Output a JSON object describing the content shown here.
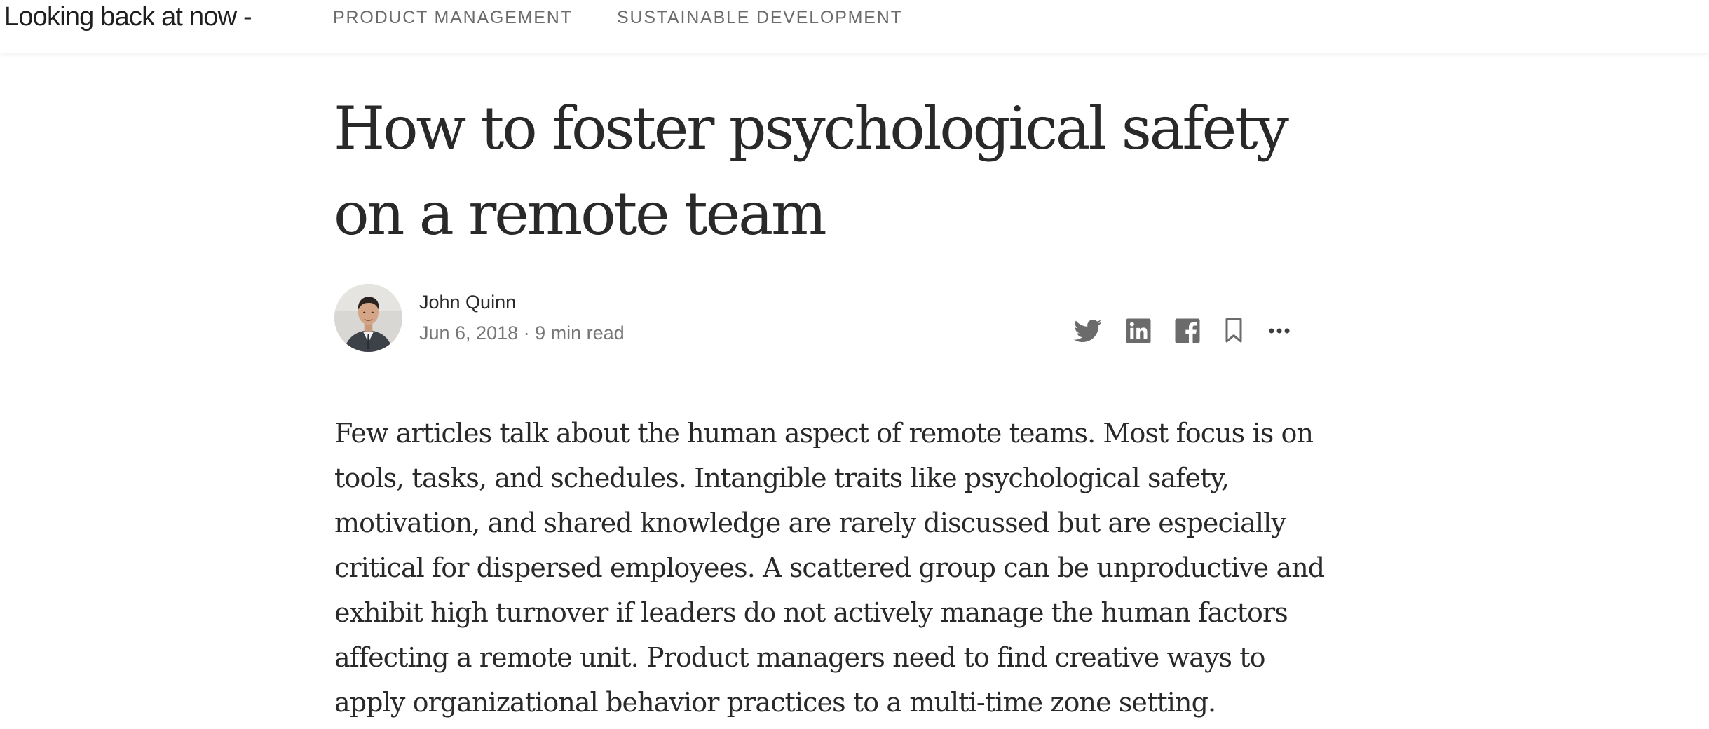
{
  "header": {
    "brand": "Looking back at now -",
    "nav": [
      {
        "label": "PRODUCT MANAGEMENT"
      },
      {
        "label": "SUSTAINABLE DEVELOPMENT"
      }
    ]
  },
  "article": {
    "title_lines": [
      "How to foster psychological safety",
      "on a remote team"
    ],
    "author": {
      "name": "John Quinn",
      "meta": "Jun 6, 2018 · 9 min read"
    },
    "actions": [
      {
        "icon": "twitter-icon"
      },
      {
        "icon": "linkedin-icon"
      },
      {
        "icon": "facebook-icon"
      },
      {
        "icon": "bookmark-icon"
      },
      {
        "icon": "more-options-icon"
      }
    ],
    "body_lines": [
      "Few articles talk about the human aspect of remote teams. Most focus is on",
      "tools, tasks, and schedules. Intangible traits like psychological safety,",
      "motivation, and shared knowledge are rarely discussed but are especially",
      "critical for dispersed employees. A scattered group can be unproductive and",
      "exhibit high turnover if leaders do not actively manage the human factors",
      "affecting a remote unit. Product managers need to find creative ways to",
      "apply organizational behavior practices to a multi-time zone setting."
    ]
  }
}
